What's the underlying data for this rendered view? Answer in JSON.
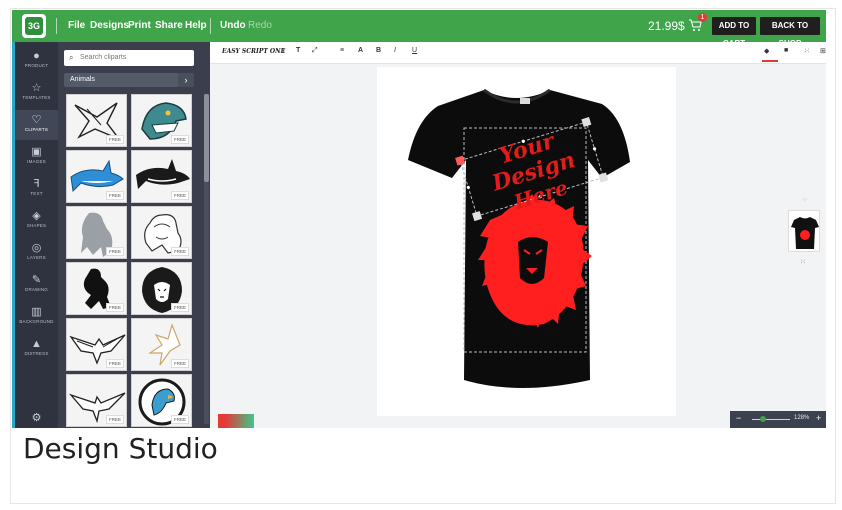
{
  "app": {
    "logo_text": "3G",
    "menu": [
      "File",
      "Designs",
      "Print",
      "Share",
      "Help"
    ],
    "undo_label": "Undo",
    "redo_label": "Redo",
    "price": "21.99$",
    "cart_count": "1",
    "add_to_cart_label": "ADD TO CART",
    "back_to_shop_label": "BACK TO SHOP"
  },
  "sidebar": {
    "items": [
      {
        "label": "PRODUCT",
        "icon": "product-icon"
      },
      {
        "label": "TEMPLATES",
        "icon": "templates-icon"
      },
      {
        "label": "CLIPARTS",
        "icon": "cliparts-icon",
        "active": true
      },
      {
        "label": "IMAGES",
        "icon": "images-icon"
      },
      {
        "label": "TEXT",
        "icon": "text-icon"
      },
      {
        "label": "SHAPES",
        "icon": "shapes-icon"
      },
      {
        "label": "LAYERS",
        "icon": "layers-icon"
      },
      {
        "label": "DRAWING",
        "icon": "drawing-icon"
      },
      {
        "label": "BACKGROUND",
        "icon": "background-icon"
      },
      {
        "label": "DISTRESS",
        "icon": "distress-icon"
      }
    ]
  },
  "cliparts": {
    "search_placeholder": "Search cliparts",
    "category": "Animals",
    "free_badge": "FREE",
    "tiles": [
      {
        "name": "shark-sketch"
      },
      {
        "name": "shark-mascot"
      },
      {
        "name": "blue-shark"
      },
      {
        "name": "black-shark"
      },
      {
        "name": "gray-lion"
      },
      {
        "name": "lion-outline"
      },
      {
        "name": "black-lion-rampant"
      },
      {
        "name": "lion-head"
      },
      {
        "name": "eagle-black"
      },
      {
        "name": "eagle-gold"
      },
      {
        "name": "eagle-flying"
      },
      {
        "name": "eagle-circle"
      }
    ]
  },
  "toolbar": {
    "font_name": "EASY SCRIPT ONE",
    "buttons": [
      "T",
      "A",
      "B",
      "I",
      "U"
    ]
  },
  "design": {
    "text_line1": "Your Design",
    "text_line2": "Here",
    "text_color": "#e21b1b",
    "shirt_color": "#0c0c0c",
    "art_color": "#ff1f1f"
  },
  "zoom": {
    "minus": "−",
    "plus": "+",
    "percent": "128%"
  },
  "caption": "Design Studio"
}
